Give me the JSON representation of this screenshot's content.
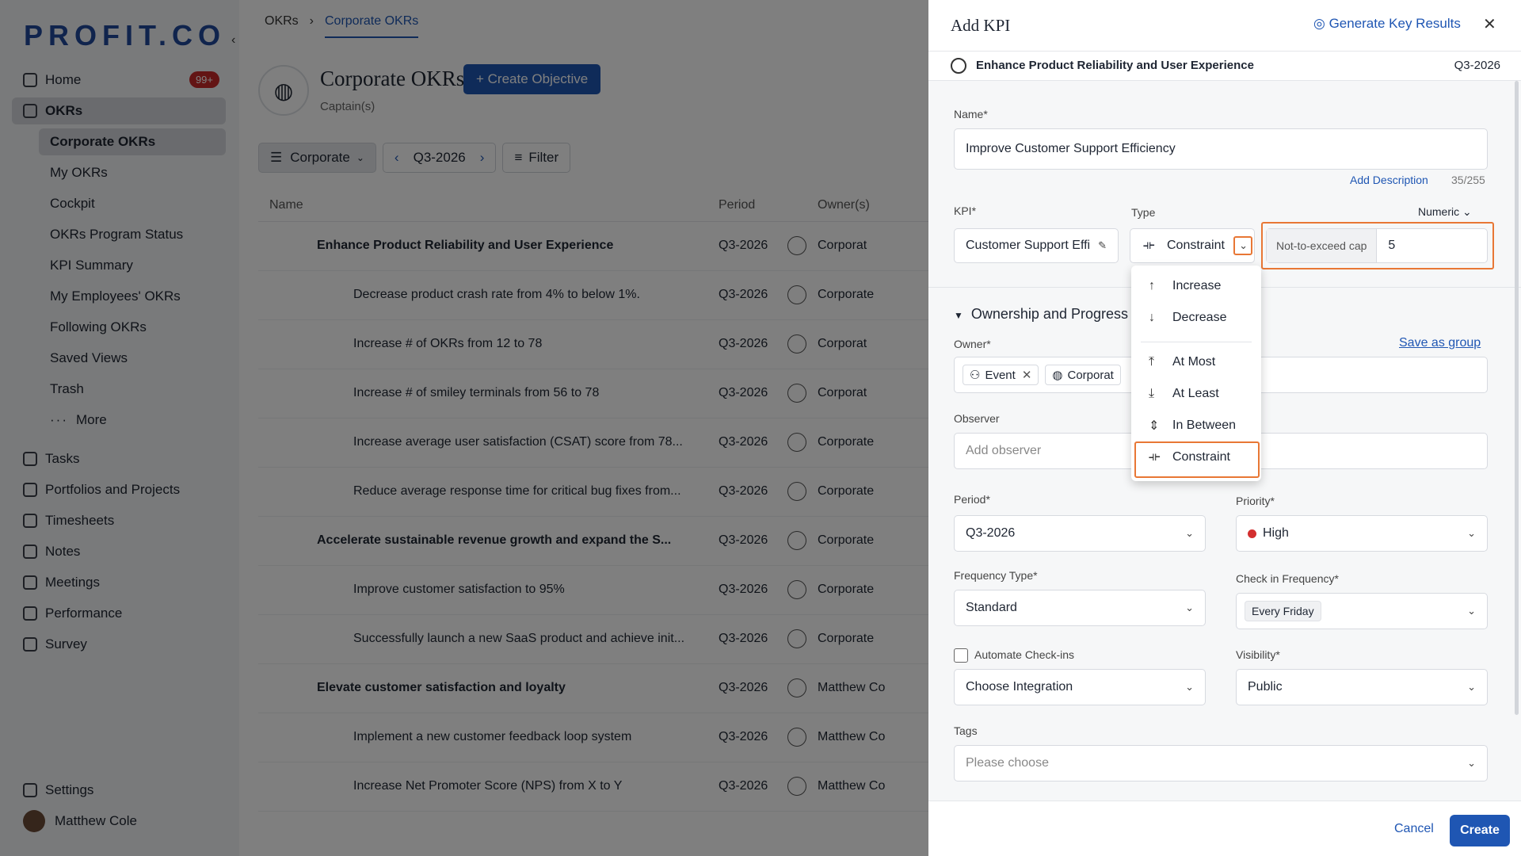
{
  "sidebar": {
    "logo": "PROFIT.CO",
    "badge": "99+",
    "items": [
      {
        "label": "Home"
      },
      {
        "label": "OKRs"
      }
    ],
    "sub": [
      "Corporate OKRs",
      "My OKRs",
      "Cockpit",
      "OKRs Program Status",
      "KPI Summary",
      "My Employees' OKRs",
      "Following OKRs",
      "Saved Views",
      "Trash",
      "More"
    ],
    "items2": [
      "Tasks",
      "Portfolios and Projects",
      "Timesheets",
      "Notes",
      "Meetings",
      "Performance",
      "Survey"
    ],
    "settings": "Settings",
    "user": "Matthew Cole"
  },
  "main": {
    "crumb_root": "OKRs",
    "crumb_current": "Corporate OKRs",
    "title": "Corporate OKRs",
    "captains": "Captain(s)",
    "create_objective": "+ Create Objective",
    "toolbar": {
      "view": "Corporate",
      "period": "Q3-2026",
      "filter": "Filter"
    },
    "headers": {
      "name": "Name",
      "period": "Period",
      "owner": "Owner(s)"
    },
    "rows": [
      {
        "name": "Enhance Product Reliability and User Experience",
        "period": "Q3-2026",
        "owner": "Corporat"
      },
      {
        "name": "Decrease product crash rate from 4% to below 1%.",
        "period": "Q3-2026",
        "owner": "Corporate"
      },
      {
        "name": "Increase # of OKRs from 12 to 78",
        "period": "Q3-2026",
        "owner": "Corporat"
      },
      {
        "name": "Increase # of smiley terminals from 56 to 78",
        "period": "Q3-2026",
        "owner": "Corporat"
      },
      {
        "name": "Increase average user satisfaction (CSAT) score from 78...",
        "period": "Q3-2026",
        "owner": "Corporate"
      },
      {
        "name": "Reduce average response time for critical bug fixes from...",
        "period": "Q3-2026",
        "owner": "Corporate"
      },
      {
        "name": "Accelerate sustainable revenue growth and expand the S...",
        "period": "Q3-2026",
        "owner": "Corporate"
      },
      {
        "name": "Improve customer satisfaction to 95%",
        "period": "Q3-2026",
        "owner": "Corporate"
      },
      {
        "name": "Successfully launch a new SaaS product and achieve init...",
        "period": "Q3-2026",
        "owner": "Corporate"
      },
      {
        "name": "Elevate customer satisfaction and loyalty",
        "period": "Q3-2026",
        "owner": "Matthew Co"
      },
      {
        "name": "Implement a new customer feedback loop system",
        "period": "Q3-2026",
        "owner": "Matthew Co"
      },
      {
        "name": "Increase Net Promoter Score (NPS) from X to Y",
        "period": "Q3-2026",
        "owner": "Matthew Co"
      }
    ]
  },
  "panel": {
    "title": "Add KPI",
    "generate": "Generate Key Results",
    "objective": "Enhance Product Reliability and User Experience",
    "objective_period": "Q3-2026",
    "name_label": "Name*",
    "name_value": "Improve Customer Support Efficiency",
    "add_description": "Add Description",
    "char_count": "35/255",
    "kpi_label": "KPI*",
    "kpi_value": "Customer Support Effi",
    "type_label": "Type",
    "type_value": "Constraint",
    "numeric": "Numeric",
    "cap_label": "Not-to-exceed cap",
    "cap_value": "5",
    "section": "Ownership and Progress",
    "owner_label": "Owner*",
    "save_group": "Save as group",
    "owner_chips": [
      "Event",
      "Corporat"
    ],
    "observer_label": "Observer",
    "observer_placeholder": "Add observer",
    "period_label": "Period*",
    "period_value": "Q3-2026",
    "priority_label": "Priority*",
    "priority_value": "High",
    "freq_type_label": "Frequency Type*",
    "freq_type_value": "Standard",
    "checkin_label": "Check in Frequency*",
    "checkin_value": "Every Friday",
    "automate_label": "Automate Check-ins",
    "integration_placeholder": "Choose Integration",
    "visibility_label": "Visibility*",
    "visibility_value": "Public",
    "tags_label": "Tags",
    "tags_placeholder": "Please choose",
    "cancel": "Cancel",
    "create": "Create"
  },
  "dropdown": {
    "items": [
      "Increase",
      "Decrease",
      "At Most",
      "At Least",
      "In Between",
      "Constraint"
    ]
  }
}
